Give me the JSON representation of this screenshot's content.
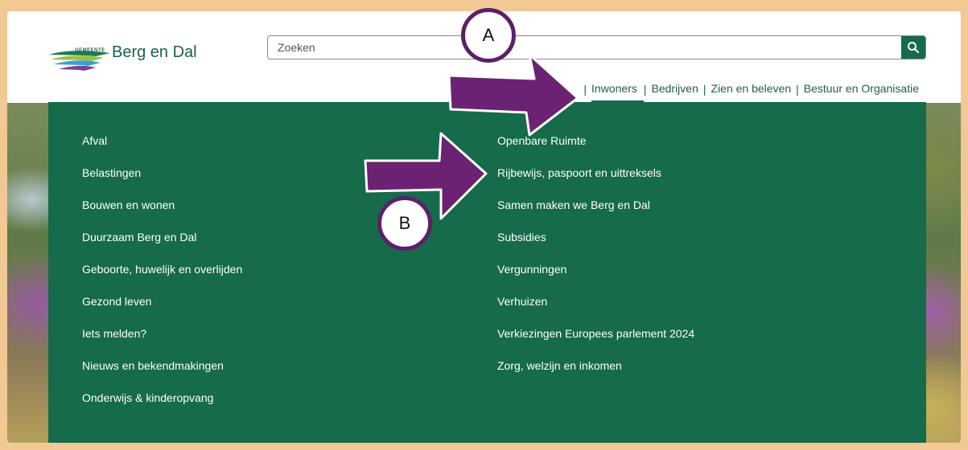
{
  "logo": {
    "small_text": "GEMEENTE",
    "name": "Berg en Dal"
  },
  "search": {
    "placeholder": "Zoeken",
    "button_icon": "search-icon"
  },
  "topnav": {
    "items": [
      {
        "label": "Inwoners",
        "active": true
      },
      {
        "label": "Bedrijven",
        "active": false
      },
      {
        "label": "Zien en beleven",
        "active": false
      },
      {
        "label": "Bestuur en Organisatie",
        "active": false
      }
    ],
    "separator": "|"
  },
  "menu": {
    "left": [
      "Afval",
      "Belastingen",
      "Bouwen en wonen",
      "Duurzaam Berg en Dal",
      "Geboorte, huwelijk en overlijden",
      "Gezond leven",
      "Iets melden?",
      "Nieuws en bekendmakingen",
      "Onderwijs & kinderopvang"
    ],
    "right": [
      "Openbare Ruimte",
      "Rijbewijs, paspoort en uittreksels",
      "Samen maken we Berg en Dal",
      "Subsidies",
      "Vergunningen",
      "Verhuizen",
      "Verkiezingen Europees parlement 2024",
      "Zorg, welzijn en inkomen"
    ]
  },
  "annotations": {
    "a": "A",
    "b": "B"
  },
  "colors": {
    "brand_green": "#156b4a",
    "annotation_purple": "#6b2272",
    "frame": "#f2c894"
  }
}
